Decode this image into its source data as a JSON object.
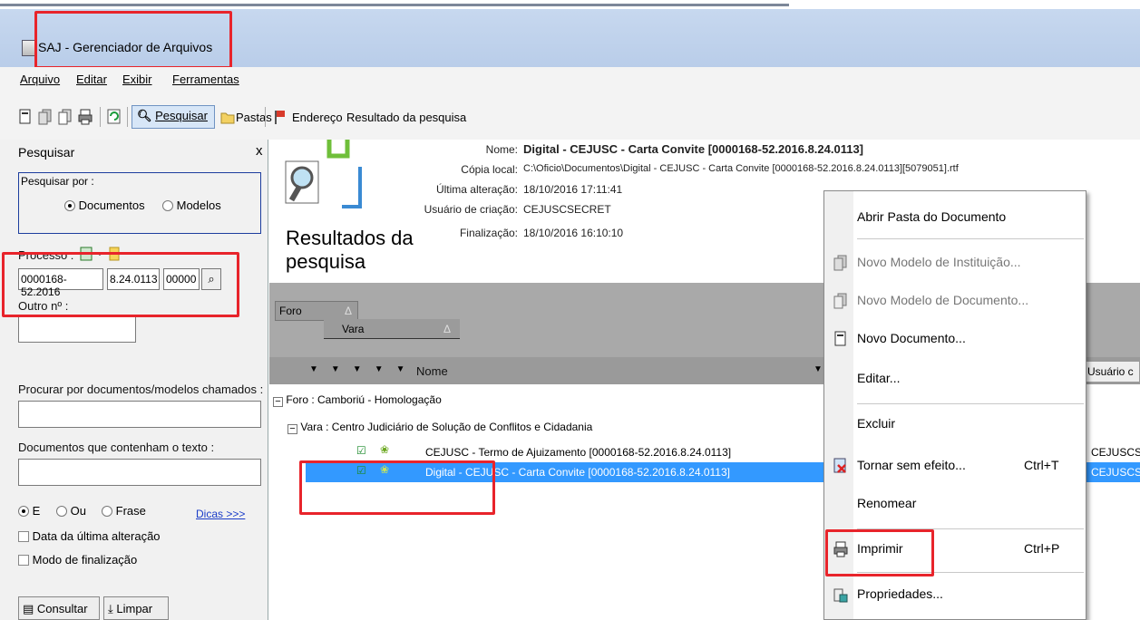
{
  "window": {
    "title": "SAJ - Gerenciador de Arquivos"
  },
  "menu": [
    "Arquivo",
    "Editar",
    "Exibir",
    "Ferramentas"
  ],
  "toolbar": {
    "search_label": "Pesquisar",
    "folders_label": "Pastas",
    "address_label": "Endereço",
    "address_value": "Resultado da pesquisa"
  },
  "search_panel": {
    "title": "Pesquisar",
    "close": "x",
    "search_by_label": "Pesquisar por :",
    "options": [
      "Documentos",
      "Modelos"
    ],
    "process_label": "Processo :",
    "process_parts": [
      "0000168-52.2016",
      "8.24.0113",
      "00000"
    ],
    "other_label": "Outro nº :",
    "other_value": "",
    "docs_named_label": "Procurar por documentos/modelos chamados :",
    "docs_named_value": "",
    "docs_text_label": "Documentos que contenham o texto :",
    "docs_text_value": "",
    "logic_options": [
      "E",
      "Ou",
      "Frase"
    ],
    "tips_link": "Dicas >>>",
    "check_last_change": "Data da última alteração",
    "check_finalization": "Modo de finalização",
    "consult_button": "Consultar",
    "clear_button": "Limpar"
  },
  "details": {
    "heading": "Resultados da pesquisa",
    "heading_line1": "Resultados da",
    "heading_line2": "pesquisa",
    "name_label": "Nome:",
    "name_value": "Digital - CEJUSC - Carta Convite [0000168-52.2016.8.24.0113]",
    "copy_label": "Cópia local:",
    "copy_value": "C:\\Oficio\\Documentos\\Digital - CEJUSC - Carta Convite [0000168-52.2016.8.24.0113][5079051].rtf",
    "changed_label": "Última alteração:",
    "changed_value": "18/10/2016 17:11:41",
    "user_label": "Usuário de criação:",
    "user_value": "CEJUSCSECRET",
    "final_label": "Finalização:",
    "final_value": "18/10/2016 16:10:10"
  },
  "grouping": {
    "foro": "Foro",
    "vara": "Vara",
    "sort_arrow": "Δ"
  },
  "columns": {
    "name": "Nome",
    "user": "Usuário c"
  },
  "tree": {
    "foro_node": "Foro : Camboriú - Homologação",
    "vara_node": "Vara : Centro Judiciário de Solução de Conflitos e Cidadania",
    "rows": [
      {
        "name": "CEJUSC - Termo de Ajuizamento [0000168-52.2016.8.24.0113]",
        "user": "CEJUSCS",
        "selected": false
      },
      {
        "name": "Digital - CEJUSC - Carta Convite [0000168-52.2016.8.24.0113]",
        "user": "CEJUSCS",
        "selected": true
      }
    ]
  },
  "context_menu": [
    {
      "label": "Abrir Pasta do Documento",
      "shortcut": "",
      "disabled": false
    },
    {
      "label": "Novo Modelo de Instituição...",
      "shortcut": "",
      "disabled": true
    },
    {
      "label": "Novo Modelo de Documento...",
      "shortcut": "",
      "disabled": true
    },
    {
      "label": "Novo Documento...",
      "shortcut": "",
      "disabled": false
    },
    {
      "label": "Editar...",
      "shortcut": "",
      "disabled": false
    },
    {
      "label": "Excluir",
      "shortcut": "",
      "disabled": false
    },
    {
      "label": "Tornar sem efeito...",
      "shortcut": "Ctrl+T",
      "disabled": false
    },
    {
      "label": "Renomear",
      "shortcut": "",
      "disabled": false
    },
    {
      "label": "Imprimir",
      "shortcut": "Ctrl+P",
      "disabled": false
    },
    {
      "label": "Propriedades...",
      "shortcut": "",
      "disabled": false
    }
  ],
  "colors": {
    "highlight": "#e8242b",
    "selection": "#3399ff",
    "titlebar": "#c2d5ee"
  }
}
